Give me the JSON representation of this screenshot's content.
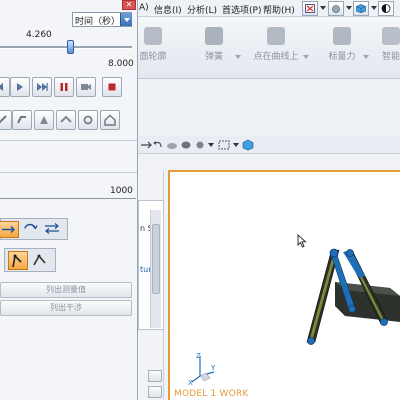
{
  "dialog": {
    "time_unit_select": "时间（秒）",
    "current_time": "4.260",
    "slider_fraction": 0.532,
    "end_time": "8.000",
    "steps_value": "1000",
    "list_measurements_button": "列出测量值",
    "list_interference_button": "列出干涉",
    "close_label": "✕"
  },
  "menubar": {
    "items": [
      "A)",
      "信息(I)",
      "分析(L)",
      "首选项(P)",
      "帮助(H)"
    ]
  },
  "commands": [
    {
      "label": "面轮廓"
    },
    {
      "label": "弹簧"
    },
    {
      "label": "点在曲线上"
    },
    {
      "label": "标量力"
    },
    {
      "label": "智能"
    }
  ],
  "navigator": {
    "partial_text_1": "n S",
    "partial_text_2": "tur"
  },
  "graphics": {
    "view_label": "MODEL 1 WORK"
  },
  "colors": {
    "accent_orange": "#e59a3a",
    "mechanism_blue": "#1f6fb8",
    "mechanism_dark": "#2a2f2a",
    "mechanism_olive": "#7a8b3a"
  }
}
